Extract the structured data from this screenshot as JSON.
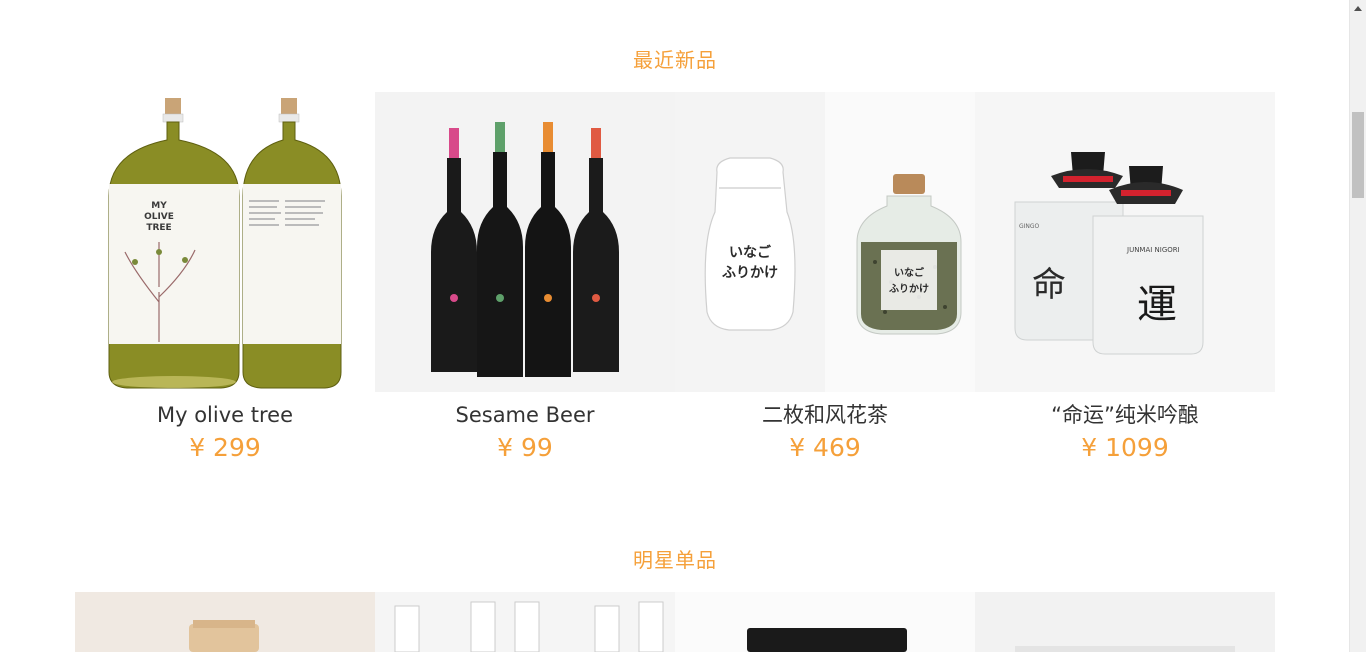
{
  "sections": {
    "recent": {
      "title": "最近新品"
    },
    "star": {
      "title": "明星单品"
    }
  },
  "products": [
    {
      "name": "My olive tree",
      "price": "¥ 299"
    },
    {
      "name": "Sesame Beer",
      "price": "¥ 99"
    },
    {
      "name": "二枚和风花茶",
      "price": "¥ 469"
    },
    {
      "name": "“命运”纯米吟酿",
      "price": "¥ 1099"
    }
  ],
  "label_art": {
    "olive_label": "MY\nOLIVE\nTREE",
    "kanji_left": "命",
    "kanji_right": "運",
    "furikake": "いなご\nふりかけ",
    "sake_brand": "JUNMAI NIGORI",
    "ginjo": "GINGO"
  },
  "colors": {
    "accent": "#f5a03a",
    "text": "#333333"
  }
}
